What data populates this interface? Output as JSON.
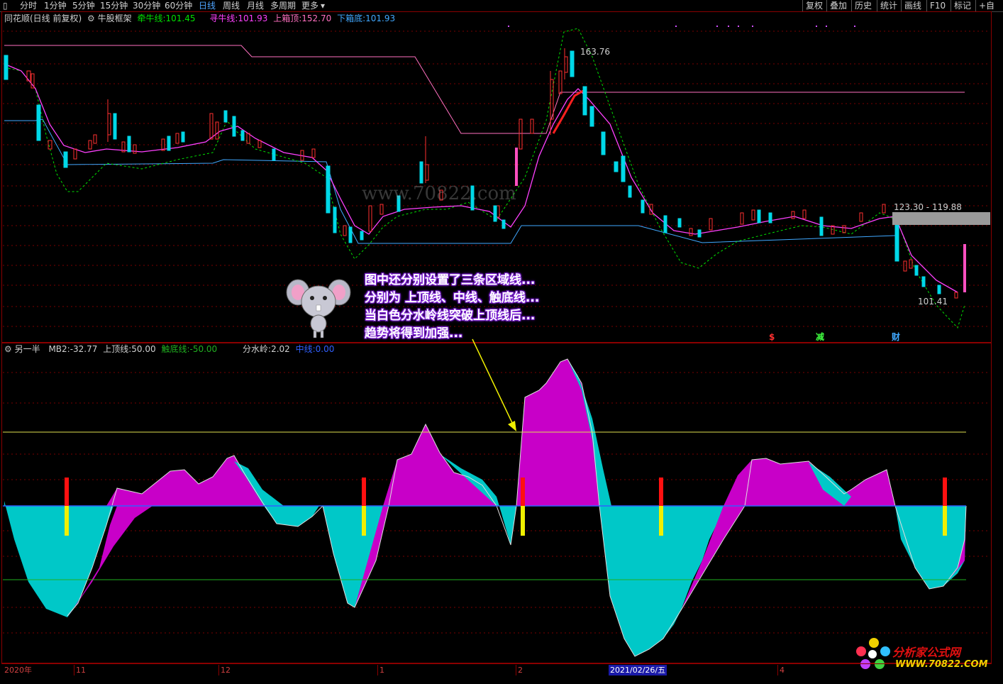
{
  "toolbar": {
    "periods": [
      "分时",
      "1分钟",
      "5分钟",
      "15分钟",
      "30分钟",
      "60分钟",
      "日线",
      "周线",
      "月线",
      "多周期",
      "更多"
    ],
    "right_buttons": [
      "复权",
      "叠加",
      "历史",
      "统计",
      "画线",
      "F10",
      "标记",
      "+自"
    ]
  },
  "main_header": {
    "stock": "同花顺(日线 前复权)",
    "indicator": "牛股框架",
    "qianniu_label": "牵牛线:",
    "qianniu_value": "101.45",
    "xunniu_label": "寻牛线:",
    "xunniu_value": "101.93",
    "upper_label": "上箱顶:",
    "upper_value": "152.70",
    "lower_label": "下箱底:",
    "lower_value": "101.93"
  },
  "sub_header": {
    "indicator": "另一半",
    "mb2_label": "MB2:",
    "mb2_value": "-32.77",
    "top_label": "上顶线:",
    "top_value": "50.00",
    "bottom_label": "触底线:",
    "bottom_value": "-50.00",
    "fsl_label": "分水岭:",
    "fsl_value": "2.02",
    "mid_label": "中线:",
    "mid_value": "0.00"
  },
  "price_labels": {
    "high": "163.76",
    "range": "123.30 - 119.88",
    "low": "101.41"
  },
  "signals": [
    "$",
    "减",
    "财"
  ],
  "annotation": {
    "line1": "图中还分别设置了三条区域线...",
    "line2": "分别为 上顶线、中线、触底线...",
    "line3": "当白色分水岭线突破上顶线后...",
    "line4": "趋势将得到加强..."
  },
  "time_axis": {
    "year": "2020年",
    "m11": "11",
    "m12": "12",
    "m1": "1",
    "m2": "2",
    "selected": "2021/02/26/五",
    "m4": "4"
  },
  "watermark": "www.70822.com",
  "brand": {
    "name": "分析家公式网",
    "url": "WWW.70822.COM"
  },
  "colors": {
    "up": "#ff3030",
    "down": "#00d8e8",
    "qianniu": "#00e000",
    "xunniu": "#ff40ff",
    "upper_box": "#ff70c0",
    "lower_box": "#40a8ff",
    "magenta_fill": "#c800c8",
    "cyan_fill": "#00c8c8"
  }
}
